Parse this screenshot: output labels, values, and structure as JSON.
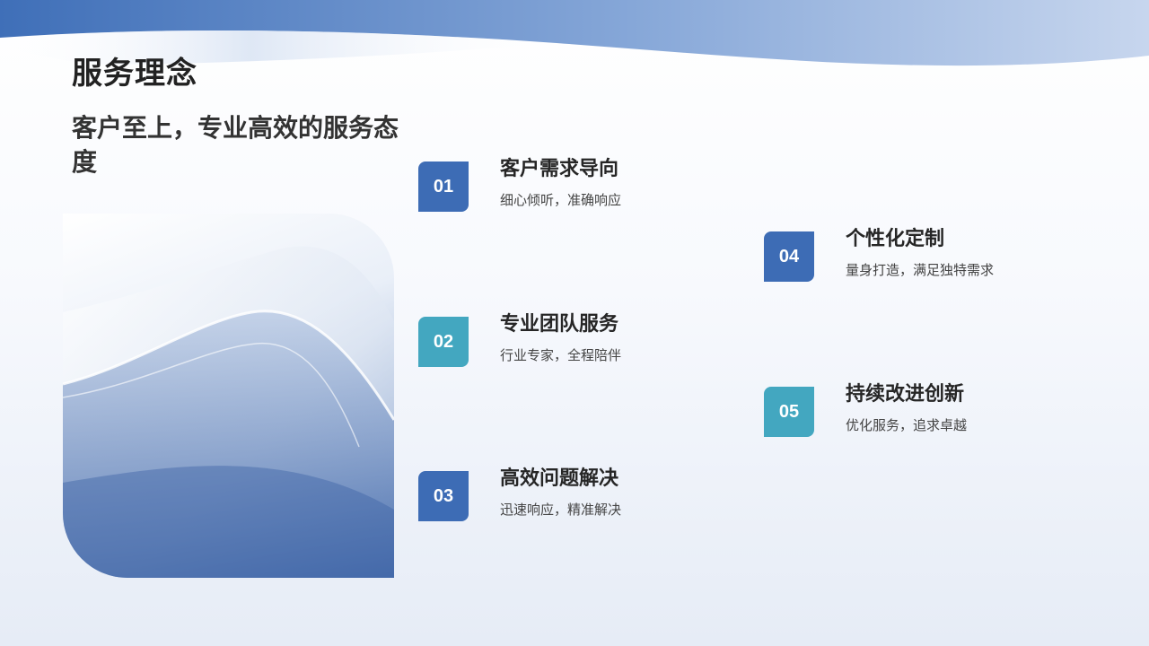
{
  "slide": {
    "title": "服务理念",
    "subtitle": "客户至上，专业高效的服务态度",
    "items": [
      {
        "number": "01",
        "title": "客户需求导向",
        "description": "细心倾听，准确响应"
      },
      {
        "number": "02",
        "title": "专业团队服务",
        "description": "行业专家，全程陪伴"
      },
      {
        "number": "03",
        "title": "高效问题解决",
        "description": "迅速响应，精准解决"
      },
      {
        "number": "04",
        "title": "个性化定制",
        "description": "量身打造，满足独特需求"
      },
      {
        "number": "05",
        "title": "持续改进创新",
        "description": "优化服务，追求卓越"
      }
    ]
  },
  "colors": {
    "badge_dark": "#3d6cb5",
    "badge_teal": "#43a7c0",
    "wave_blue": "#3f6fb8"
  }
}
